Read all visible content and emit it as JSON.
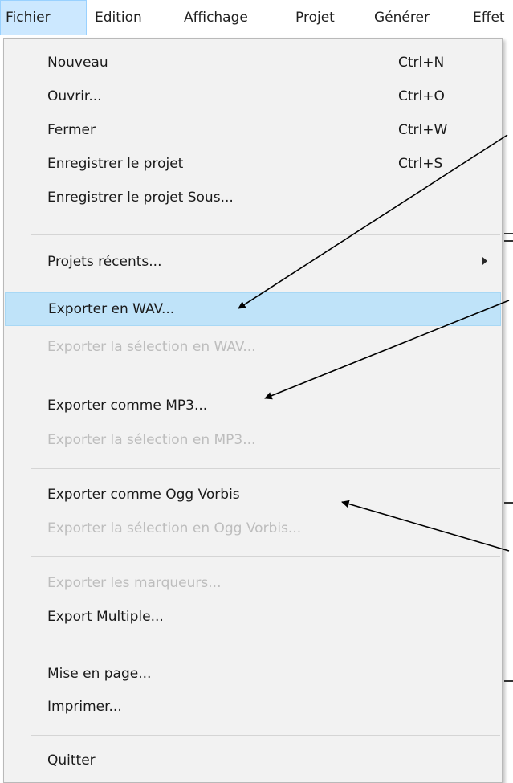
{
  "menubar": {
    "items": [
      {
        "label": "Fichier"
      },
      {
        "label": "Edition"
      },
      {
        "label": "Affichage"
      },
      {
        "label": "Projet"
      },
      {
        "label": "Générer"
      },
      {
        "label": "Effet"
      }
    ]
  },
  "menu": {
    "items": [
      {
        "label": "Nouveau",
        "shortcut": "Ctrl+N",
        "disabled": false
      },
      {
        "label": "Ouvrir...",
        "shortcut": "Ctrl+O",
        "disabled": false
      },
      {
        "label": "Fermer",
        "shortcut": "Ctrl+W",
        "disabled": false
      },
      {
        "label": "Enregistrer le projet",
        "shortcut": "Ctrl+S",
        "disabled": false
      },
      {
        "label": "Enregistrer le projet Sous...",
        "shortcut": "",
        "disabled": false
      },
      {
        "label": "Projets récents...",
        "shortcut": "",
        "disabled": false,
        "submenu": true
      },
      {
        "label": "Exporter en WAV...",
        "shortcut": "",
        "disabled": false,
        "highlighted": true
      },
      {
        "label": "Exporter la sélection en WAV...",
        "shortcut": "",
        "disabled": true
      },
      {
        "label": "Exporter comme MP3...",
        "shortcut": "",
        "disabled": false
      },
      {
        "label": "Exporter la sélection en MP3...",
        "shortcut": "",
        "disabled": true
      },
      {
        "label": "Exporter comme Ogg Vorbis",
        "shortcut": "",
        "disabled": false
      },
      {
        "label": "Exporter la sélection en Ogg Vorbis...",
        "shortcut": "",
        "disabled": true
      },
      {
        "label": "Exporter les marqueurs...",
        "shortcut": "",
        "disabled": true
      },
      {
        "label": "Export Multiple...",
        "shortcut": "",
        "disabled": false
      },
      {
        "label": "Mise en page...",
        "shortcut": "",
        "disabled": false
      },
      {
        "label": "Imprimer...",
        "shortcut": "",
        "disabled": false
      },
      {
        "label": "Quitter",
        "shortcut": "",
        "disabled": false
      }
    ]
  },
  "icons": {
    "submenu": "chevron-right-icon",
    "annotation": "arrow-pointer"
  },
  "colors": {
    "menubar_active_bg": "#cce8ff",
    "menu_bg": "#f2f2f2",
    "hover_bg": "#bfe3f9",
    "disabled_text": "#bdbdbd",
    "separator": "#d5d5d5",
    "arrow": "#000000"
  }
}
